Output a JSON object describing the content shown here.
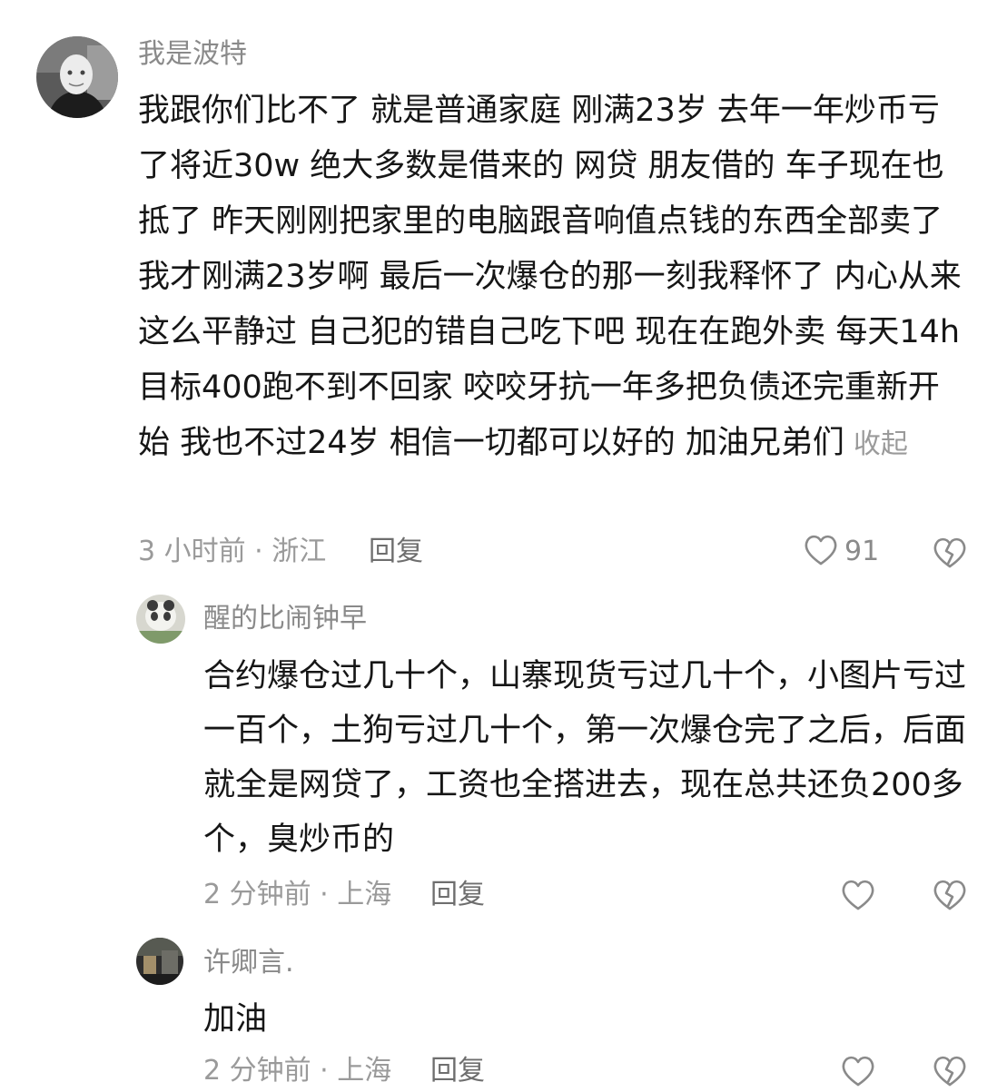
{
  "comments": [
    {
      "username": "我是波特",
      "text": "我跟你们比不了 就是普通家庭 刚满23岁 去年一年炒币亏了将近30w 绝大多数是借来的 网贷 朋友借的 车子现在也抵了 昨天刚刚把家里的电脑跟音响值点钱的东西全部卖了 我才刚满23岁啊 最后一次爆仓的那一刻我释怀了 内心从来这么平静过 自己犯的错自己吃下吧 现在在跑外卖 每天14h目标400跑不到不回家 咬咬牙抗一年多把负债还完重新开始 我也不过24岁 相信一切都可以好的 加油兄弟们",
      "collapse_label": "收起",
      "time_location": "3 小时前 · 浙江",
      "reply_label": "回复",
      "like_count": "91"
    }
  ],
  "replies": [
    {
      "username": "醒的比闹钟早",
      "text": "合约爆仓过几十个，山寨现货亏过几十个，小图片亏过一百个，土狗亏过几十个，第一次爆仓完了之后，后面就全是网贷了，工资也全搭进去，现在总共还负200多个，臭炒币的",
      "time_location": "2 分钟前 · 上海",
      "reply_label": "回复"
    },
    {
      "username": "许卿言.",
      "text": "加油",
      "time_location": "2 分钟前 · 上海",
      "reply_label": "回复"
    }
  ],
  "icons": {
    "like": "heart-outline-icon",
    "dislike": "broken-heart-icon"
  },
  "colors": {
    "username": "#8a8a8a",
    "text": "#161616",
    "meta": "#9a9a9a",
    "icon": "#8a8a8a"
  }
}
